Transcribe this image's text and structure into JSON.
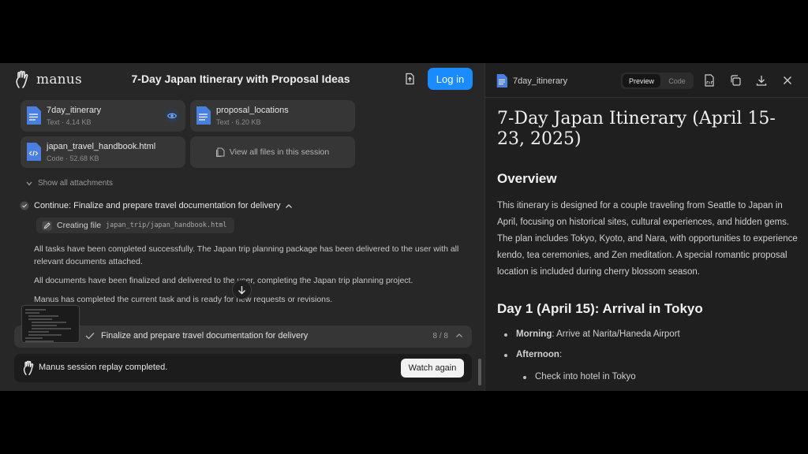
{
  "app": {
    "name": "manus"
  },
  "chat": {
    "title": "7-Day Japan Itinerary with Proposal Ideas",
    "login_label": "Log in"
  },
  "files": [
    {
      "name": "7day_itinerary",
      "meta": "Text · 4.14 KB",
      "icon": "doc-icon"
    },
    {
      "name": "proposal_locations",
      "meta": "Text · 6.20 KB",
      "icon": "doc-icon"
    },
    {
      "name": "japan_travel_handbook.html",
      "meta": "Code · 52.68 KB",
      "icon": "code-file-icon"
    }
  ],
  "view_all_label": "View all files in this session",
  "show_all_label": "Show all attachments",
  "task": {
    "title": "Continue: Finalize and prepare travel documentation for delivery",
    "creating_label": "Creating file",
    "creating_path": "japan_trip/japan_handbook.html"
  },
  "messages": [
    "All tasks have been completed successfully. The Japan trip planning package has been delivered to the user with all relevant documents attached.",
    "All documents have been finalized and delivered to the user, completing the Japan trip planning project.",
    "Manus has completed the current task and is ready for new requests or revisions."
  ],
  "progress": {
    "label": "Finalize and prepare travel documentation for delivery",
    "count": "8 / 8"
  },
  "replay": {
    "text": "Manus session replay completed.",
    "button": "Watch again"
  },
  "preview": {
    "filename": "7day_itinerary",
    "tab_preview": "Preview",
    "tab_code": "Code",
    "title": "7-Day Japan Itinerary (April 15-23, 2025)",
    "overview_heading": "Overview",
    "overview_text": "This itinerary is designed for a couple traveling from Seattle to Japan in April, focusing on historical sites, cultural experiences, and hidden gems. The plan includes Tokyo, Kyoto, and Nara, with opportunities to experience kendo, tea ceremonies, and Zen meditation. A special romantic proposal location is included during cherry blossom season.",
    "day1_heading": "Day 1 (April 15): Arrival in Tokyo",
    "morning_label": "Morning",
    "morning_text": ": Arrive at Narita/Haneda Airport",
    "afternoon_label": "Afternoon",
    "afternoon_text": ":",
    "sub_item": "Check into hotel in Tokyo"
  },
  "colors": {
    "accent": "#1a8cff",
    "file_icon": "#4a7fe0"
  }
}
